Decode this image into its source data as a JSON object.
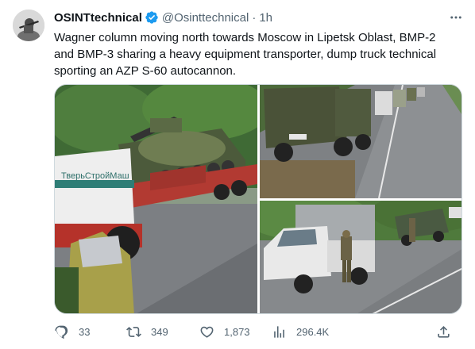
{
  "tweet": {
    "author_name": "OSINTtechnical",
    "handle": "@Osinttechnical",
    "separator": "·",
    "time": "1h",
    "text_lines": [
      "Wagner column moving north towards Moscow in Lipetsk Oblast, BMP-2",
      "and BMP-3 sharing a heavy equipment transporter, dump truck technical",
      "sporting an AZP S-60 autocannon."
    ],
    "verified_icon": "verified-badge-icon",
    "more_icon": "more-options-icon",
    "truck_sign": "ТверьСтройМаш"
  },
  "actions": {
    "reply": {
      "count": "33",
      "icon": "reply-icon"
    },
    "retweet": {
      "count": "349",
      "icon": "retweet-icon"
    },
    "like": {
      "count": "1,873",
      "icon": "heart-icon"
    },
    "views": {
      "count": "296.4K",
      "icon": "views-icon"
    },
    "share": {
      "icon": "share-icon"
    }
  },
  "colors": {
    "text": "#0f1419",
    "secondary": "#536471",
    "verified": "#1d9bf0",
    "border": "#cfd9de"
  }
}
